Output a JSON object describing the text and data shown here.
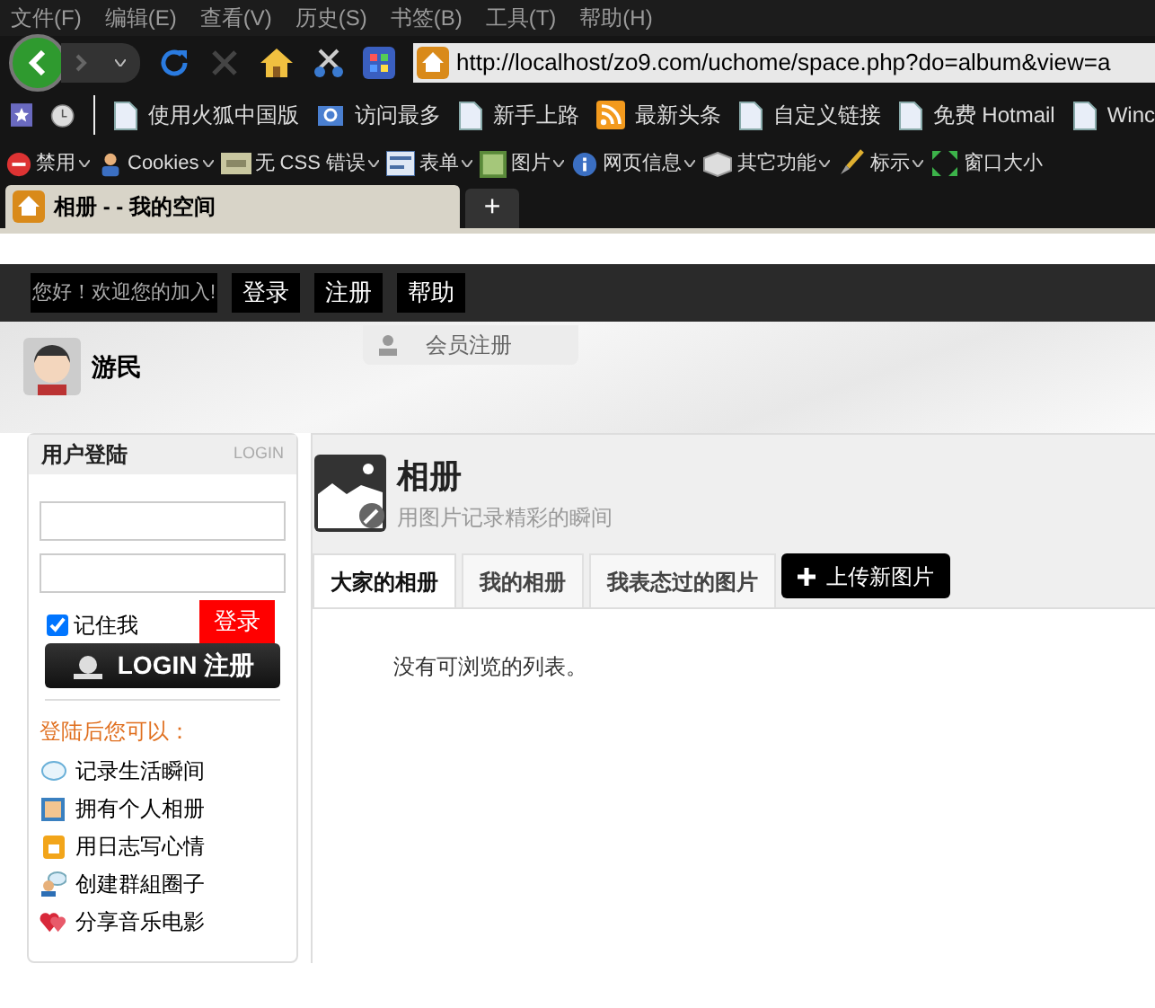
{
  "menu_bar": [
    "文件(F)",
    "编辑(E)",
    "查看(V)",
    "历史(S)",
    "书签(B)",
    "工具(T)",
    "帮助(H)"
  ],
  "address_bar": {
    "url": "http://localhost/zo9.com/uchome/space.php?do=album&view=a"
  },
  "bookmarks": [
    {
      "label": "使用火狐中国版",
      "kind": "page"
    },
    {
      "label": "访问最多",
      "kind": "folder"
    },
    {
      "label": "新手上路",
      "kind": "page"
    },
    {
      "label": "最新头条",
      "kind": "feed"
    },
    {
      "label": "自定义链接",
      "kind": "page"
    },
    {
      "label": "免费 Hotmail",
      "kind": "page"
    },
    {
      "label": "Winc",
      "kind": "page"
    }
  ],
  "dev_toolbar": [
    {
      "label": "禁用",
      "kind": "stop"
    },
    {
      "label": "Cookies",
      "kind": "person"
    },
    {
      "label": "无 CSS 错误",
      "kind": "css"
    },
    {
      "label": "表单",
      "kind": "form"
    },
    {
      "label": "图片",
      "kind": "image"
    },
    {
      "label": "网页信息",
      "kind": "info"
    },
    {
      "label": "其它功能",
      "kind": "cube"
    },
    {
      "label": "标示",
      "kind": "brush"
    },
    {
      "label": "窗口大小",
      "kind": "resize"
    }
  ],
  "tabs": [
    {
      "label": "相册 - - 我的空间",
      "selected": true
    }
  ],
  "new_tab": "+",
  "site_bar": {
    "greeting": "您好！欢迎您的加入!",
    "links": [
      "登录",
      "注册",
      "帮助"
    ]
  },
  "user": {
    "name": "游民"
  },
  "header_tab": "会员注册",
  "login_box": {
    "title": "用户登陆",
    "title_en": "LOGIN",
    "remember": {
      "label": "记住我",
      "checked": true
    },
    "submit": "登录",
    "register_banner": "LOGIN 注册",
    "perks_title": "登陆后您可以：",
    "perks": [
      {
        "label": "记录生活瞬间",
        "kind": "chat"
      },
      {
        "label": "拥有个人相册",
        "kind": "photo"
      },
      {
        "label": "用日志写心情",
        "kind": "note"
      },
      {
        "label": "创建群組圈子",
        "kind": "group"
      },
      {
        "label": "分享音乐电影",
        "kind": "heart"
      }
    ]
  },
  "album": {
    "title": "相册",
    "subtitle": "用图片记录精彩的瞬间",
    "tabs": [
      {
        "label": "大家的相册",
        "selected": true
      },
      {
        "label": "我的相册",
        "selected": false
      },
      {
        "label": "我表态过的图片",
        "selected": false
      }
    ],
    "upload_button": "上传新图片",
    "empty_message": "没有可浏览的列表。"
  }
}
